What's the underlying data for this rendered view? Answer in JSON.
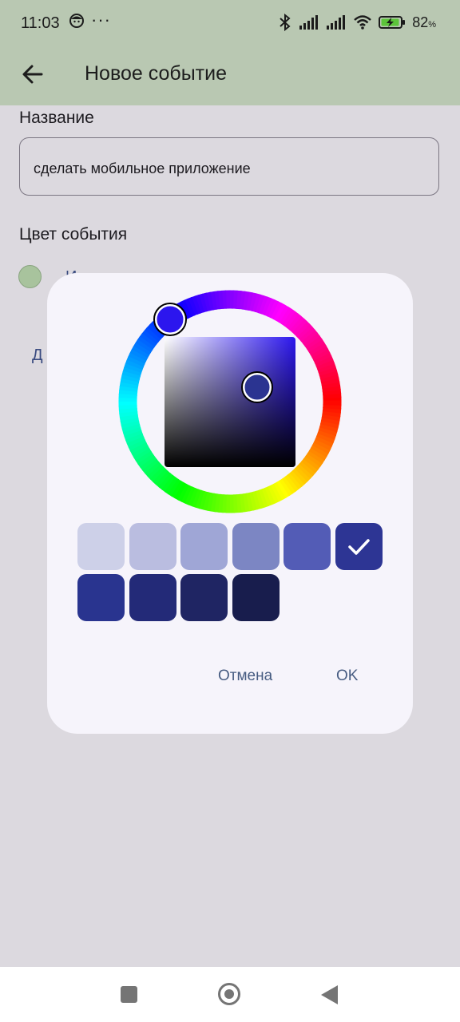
{
  "status_bar": {
    "time": "11:03",
    "dots": "···",
    "battery": "82",
    "battery_unit": "%",
    "icons": [
      "face-notification-icon",
      "bluetooth-icon",
      "signal-icon",
      "signal-icon",
      "wifi-icon",
      "battery-charging-icon"
    ]
  },
  "app_bar": {
    "title": "Новое событие",
    "back_icon": "arrow-left-icon",
    "color": "#b9c8b2"
  },
  "form": {
    "name_label": "Название",
    "name_value": "сделать мобильное приложение",
    "color_label": "Цвет события",
    "current_color": "#a8c39d",
    "obscured_row_text": "И",
    "obscured_link_text": "Д"
  },
  "dialog": {
    "picker": {
      "hue_ring": "hue-wheel",
      "selected_hue_color": "#2c16ee",
      "selected_color": "#2b3491"
    },
    "swatches": [
      {
        "color": "#cdd0e8",
        "selected": false
      },
      {
        "color": "#babde0",
        "selected": false
      },
      {
        "color": "#9fa6d6",
        "selected": false
      },
      {
        "color": "#7c86c3",
        "selected": false
      },
      {
        "color": "#535cb6",
        "selected": false
      },
      {
        "color": "#2d3594",
        "selected": true,
        "icon": "checkmark-icon"
      },
      {
        "color": "#29348f",
        "selected": false
      },
      {
        "color": "#232a78",
        "selected": false
      },
      {
        "color": "#1f2563",
        "selected": false
      },
      {
        "color": "#181d4d",
        "selected": false
      }
    ],
    "cancel_label": "Отмена",
    "ok_label": "OK"
  },
  "nav_bar": {
    "icons": [
      "recents-square-icon",
      "home-circle-icon",
      "back-triangle-icon"
    ]
  }
}
